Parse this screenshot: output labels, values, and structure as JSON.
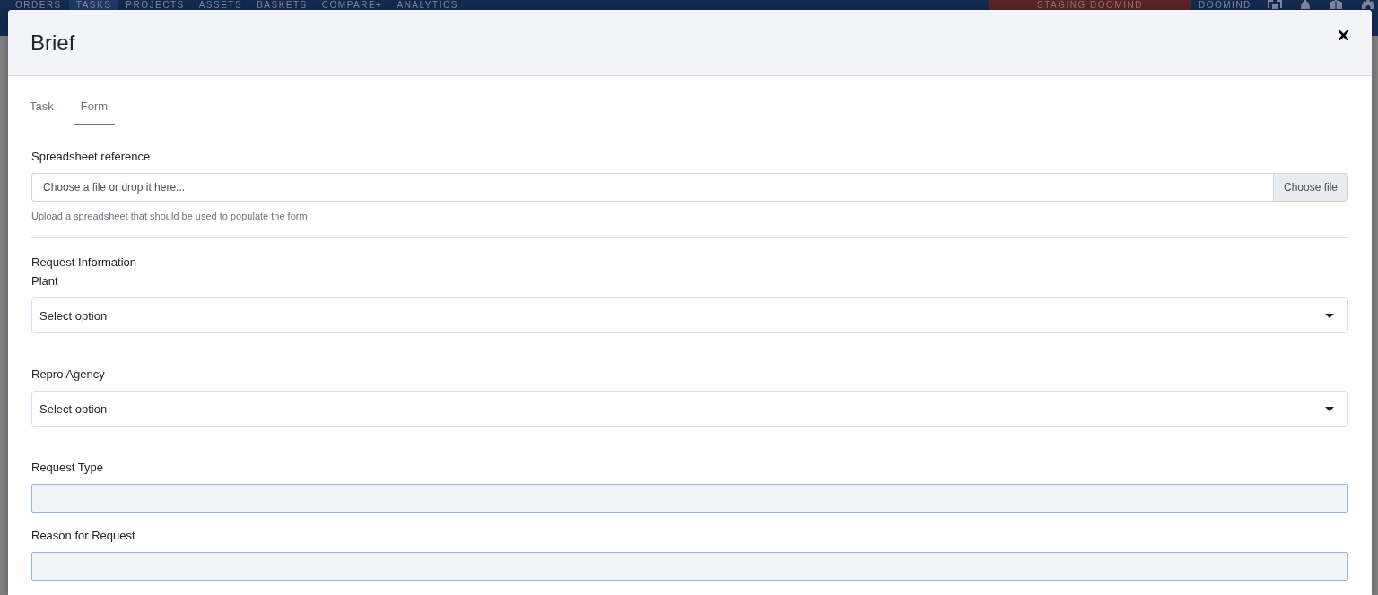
{
  "app_bar": {
    "nav_items": [
      {
        "label": "ORDERS",
        "selected": false
      },
      {
        "label": "TASKS",
        "selected": true
      },
      {
        "label": "PROJECTS",
        "selected": false
      },
      {
        "label": "ASSETS",
        "selected": false
      },
      {
        "label": "BASKETS",
        "selected": false
      },
      {
        "label": "COMPARE+",
        "selected": false
      },
      {
        "label": "ANALYTICS",
        "selected": false
      }
    ],
    "environment_badge": "STAGING DOOMIND",
    "user_menu": "DOOMIND"
  },
  "dialog": {
    "title": "Brief",
    "tabs": [
      {
        "label": "Task",
        "selected": false
      },
      {
        "label": "Form",
        "selected": true
      }
    ],
    "upload": {
      "label": "Spreadsheet reference",
      "placeholder": "Choose a file or drop it here...",
      "button": "Choose file",
      "help": "Upload a spreadsheet that should be used to populate the form"
    },
    "section_title": "Request Information",
    "fields": [
      {
        "kind": "select",
        "label": "Plant",
        "placeholder": "Select option",
        "disabled": false
      },
      {
        "kind": "select",
        "label": "Repro Agency",
        "placeholder": "Select option",
        "disabled": false
      },
      {
        "kind": "text",
        "label": "Request Type",
        "disabled": true
      },
      {
        "kind": "text",
        "label": "Reason for Request",
        "disabled": true
      }
    ]
  }
}
